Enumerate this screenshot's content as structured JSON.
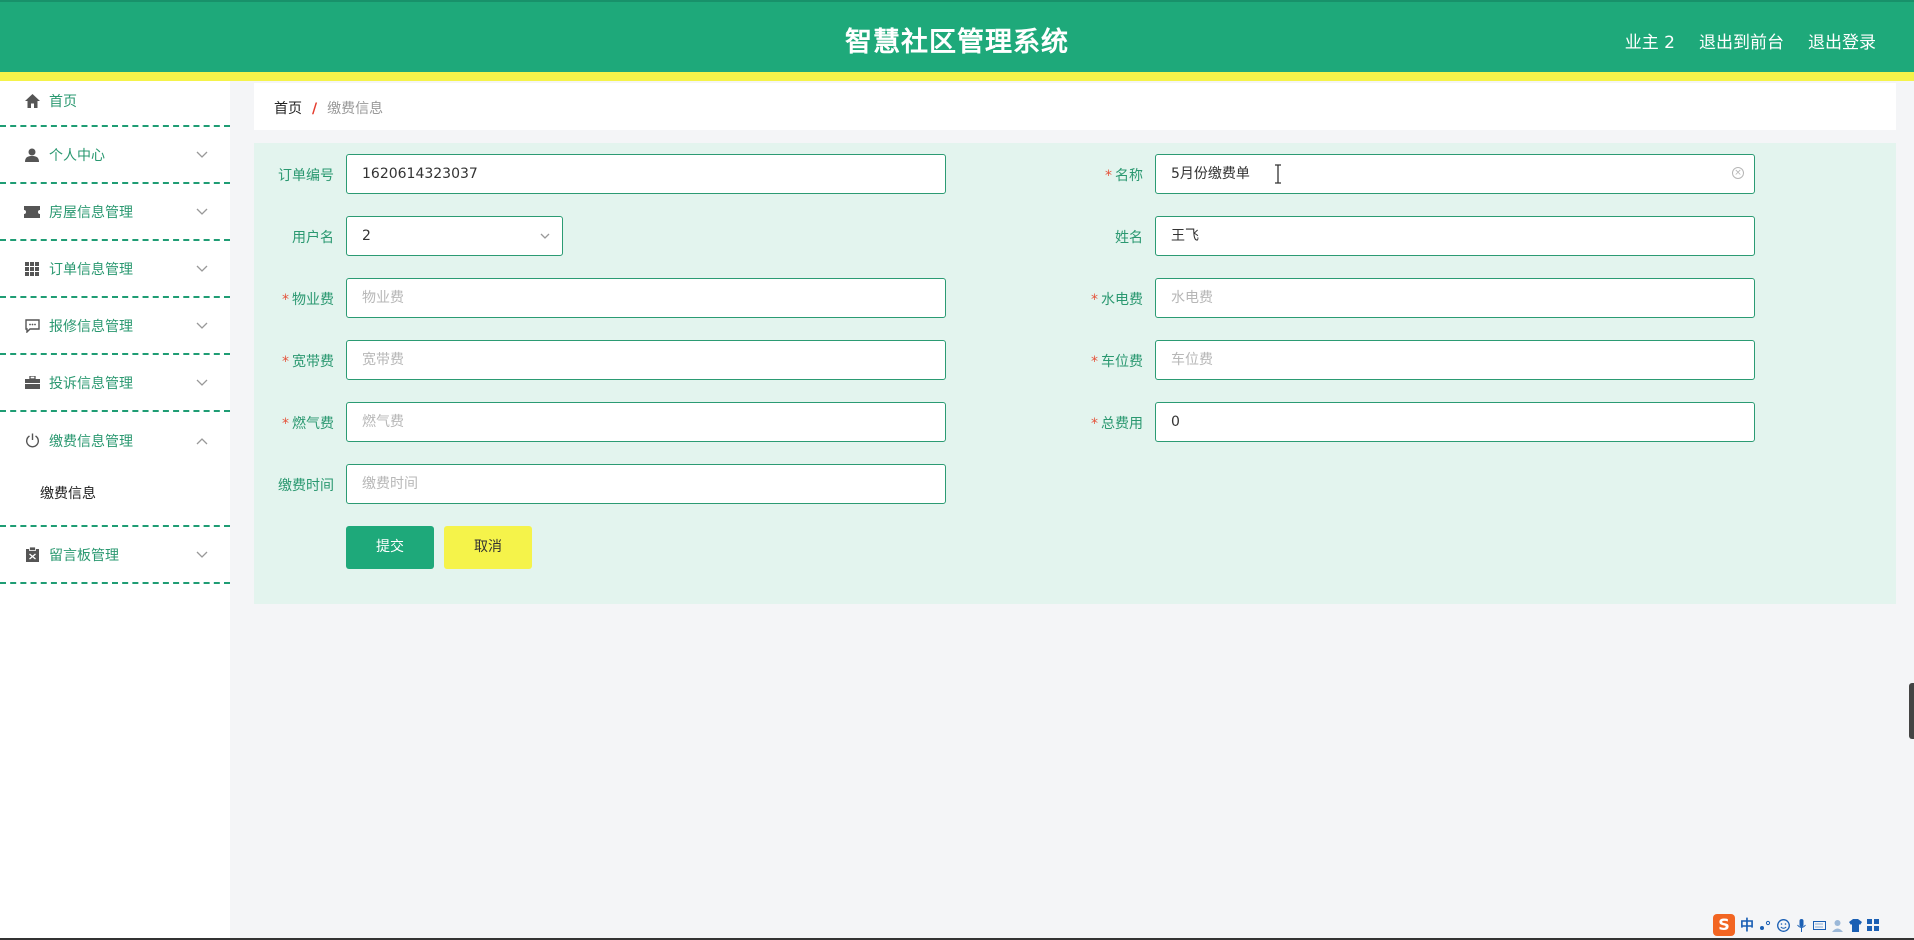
{
  "header": {
    "title": "智慧社区管理系统",
    "user": "业主 2",
    "to_front": "退出到前台",
    "logout": "退出登录"
  },
  "sidebar": {
    "items": [
      {
        "label": "首页",
        "icon": "home-icon"
      },
      {
        "label": "个人中心",
        "icon": "user-icon"
      },
      {
        "label": "房屋信息管理",
        "icon": "ticket-icon"
      },
      {
        "label": "订单信息管理",
        "icon": "grid-icon"
      },
      {
        "label": "报修信息管理",
        "icon": "chat-icon"
      },
      {
        "label": "投诉信息管理",
        "icon": "briefcase-icon"
      },
      {
        "label": "缴费信息管理",
        "icon": "power-icon",
        "expanded": true,
        "children": [
          "缴费信息"
        ]
      },
      {
        "label": "留言板管理",
        "icon": "clipboard-icon"
      }
    ]
  },
  "breadcrumb": {
    "home": "首页",
    "separator": "/",
    "current": "缴费信息"
  },
  "form": {
    "order_no": {
      "label": "订单编号",
      "value": "1620614323037"
    },
    "name": {
      "label": "名称",
      "value": "5月份缴费单",
      "required": true
    },
    "username": {
      "label": "用户名",
      "value": "2"
    },
    "real_name": {
      "label": "姓名",
      "value": "王飞"
    },
    "property_fee": {
      "label": "物业费",
      "placeholder": "物业费",
      "required": true
    },
    "utility_fee": {
      "label": "水电费",
      "placeholder": "水电费",
      "required": true
    },
    "broadband_fee": {
      "label": "宽带费",
      "placeholder": "宽带费",
      "required": true
    },
    "parking_fee": {
      "label": "车位费",
      "placeholder": "车位费",
      "required": true
    },
    "gas_fee": {
      "label": "燃气费",
      "placeholder": "燃气费",
      "required": true
    },
    "total_fee": {
      "label": "总费用",
      "value": "0",
      "required": true
    },
    "pay_time": {
      "label": "缴费时间",
      "placeholder": "缴费时间"
    },
    "required_mark": "*",
    "submit": "提交",
    "cancel": "取消"
  },
  "ime": {
    "logo": "S",
    "lang": "中"
  },
  "colors": {
    "primary": "#1ea97a",
    "accent_yellow": "#f5f34a",
    "form_bg": "#e3f4ee",
    "required": "#e5523a"
  }
}
